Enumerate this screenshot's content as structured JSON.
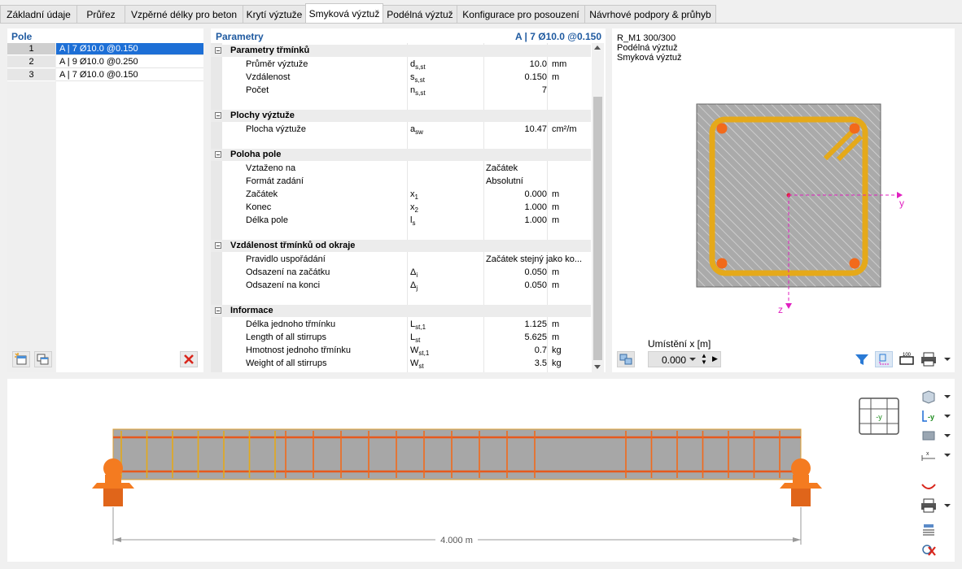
{
  "tabs": [
    {
      "label": "Základní údaje",
      "active": false
    },
    {
      "label": "Průřez",
      "active": false
    },
    {
      "label": "Vzpěrné délky pro beton",
      "active": false
    },
    {
      "label": "Krytí výztuže",
      "active": false
    },
    {
      "label": "Smyková výztuž",
      "active": true
    },
    {
      "label": "Podélná výztuž",
      "active": false
    },
    {
      "label": "Konfigurace pro posouzení",
      "active": false
    },
    {
      "label": "Návrhové podpory & průhyb",
      "active": false
    }
  ],
  "pole": {
    "header": "Pole",
    "rows": [
      {
        "num": "1",
        "text": "A | 7 Ø10.0 @0.150",
        "selected": true
      },
      {
        "num": "2",
        "text": "A | 9 Ø10.0 @0.250",
        "selected": false
      },
      {
        "num": "3",
        "text": "A | 7 Ø10.0 @0.150",
        "selected": false
      }
    ]
  },
  "params": {
    "header": "Parametry",
    "current": "A | 7 Ø10.0 @0.150",
    "groups": {
      "g1": {
        "title": "Parametry třmínků",
        "rows": [
          {
            "name": "Průměr výztuže",
            "sym": "d",
            "sub": "s,st",
            "val": "10.0",
            "unit": "mm"
          },
          {
            "name": "Vzdálenost",
            "sym": "s",
            "sub": "s,st",
            "val": "0.150",
            "unit": "m"
          },
          {
            "name": "Počet",
            "sym": "n",
            "sub": "s,st",
            "val": "7",
            "unit": ""
          }
        ]
      },
      "g2": {
        "title": "Plochy výztuže",
        "rows": [
          {
            "name": "Plocha výztuže",
            "sym": "a",
            "sub": "sw",
            "val": "10.47",
            "unit": "cm²/m"
          }
        ]
      },
      "g3": {
        "title": "Poloha pole",
        "rows": [
          {
            "name": "Vztaženo na",
            "sym": "",
            "sub": "",
            "val": "Začátek",
            "unit": ""
          },
          {
            "name": "Formát zadání",
            "sym": "",
            "sub": "",
            "val": "Absolutní",
            "unit": ""
          },
          {
            "name": "Začátek",
            "sym": "x",
            "sub": "1",
            "val": "0.000",
            "unit": "m"
          },
          {
            "name": "Konec",
            "sym": "x",
            "sub": "2",
            "val": "1.000",
            "unit": "m"
          },
          {
            "name": "Délka pole",
            "sym": "l",
            "sub": "s",
            "val": "1.000",
            "unit": "m"
          }
        ]
      },
      "g4": {
        "title": "Vzdálenost třmínků od okraje",
        "rows": [
          {
            "name": "Pravidlo uspořádání",
            "sym": "",
            "sub": "",
            "val": "Začátek stejný jako ko...",
            "unit": ""
          },
          {
            "name": "Odsazení na začátku",
            "sym": "Δ",
            "sub": "i",
            "val": "0.050",
            "unit": "m"
          },
          {
            "name": "Odsazení na konci",
            "sym": "Δ",
            "sub": "j",
            "val": "0.050",
            "unit": "m"
          }
        ]
      },
      "g5": {
        "title": "Informace",
        "rows": [
          {
            "name": "Délka jednoho třmínku",
            "sym": "L",
            "sub": "st,1",
            "val": "1.125",
            "unit": "m"
          },
          {
            "name": "Length of all stirrups",
            "sym": "L",
            "sub": "st",
            "val": "5.625",
            "unit": "m"
          },
          {
            "name": "Hmotnost jednoho třmínku",
            "sym": "W",
            "sub": "st,1",
            "val": "0.7",
            "unit": "kg"
          },
          {
            "name": "Weight of all stirrups",
            "sym": "W",
            "sub": "st",
            "val": "3.5",
            "unit": "kg"
          }
        ]
      }
    }
  },
  "section": {
    "line1": "R_M1 300/300",
    "line2": "Podélná výztuž",
    "line3": "Smyková výztuž",
    "axis_y": "y",
    "axis_z": "z",
    "location_label": "Umístění x [m]",
    "location_value": "0.000"
  },
  "beam": {
    "dimension_label": "4.000 m",
    "view_axis_label": "-y"
  },
  "colors": {
    "accent": "#1d6fd6",
    "stirrup_gold": "#e5a91a",
    "rebar": "#f26a1b",
    "axis": "#e020c0",
    "support": "#f47b20",
    "delete": "#d9261c"
  }
}
